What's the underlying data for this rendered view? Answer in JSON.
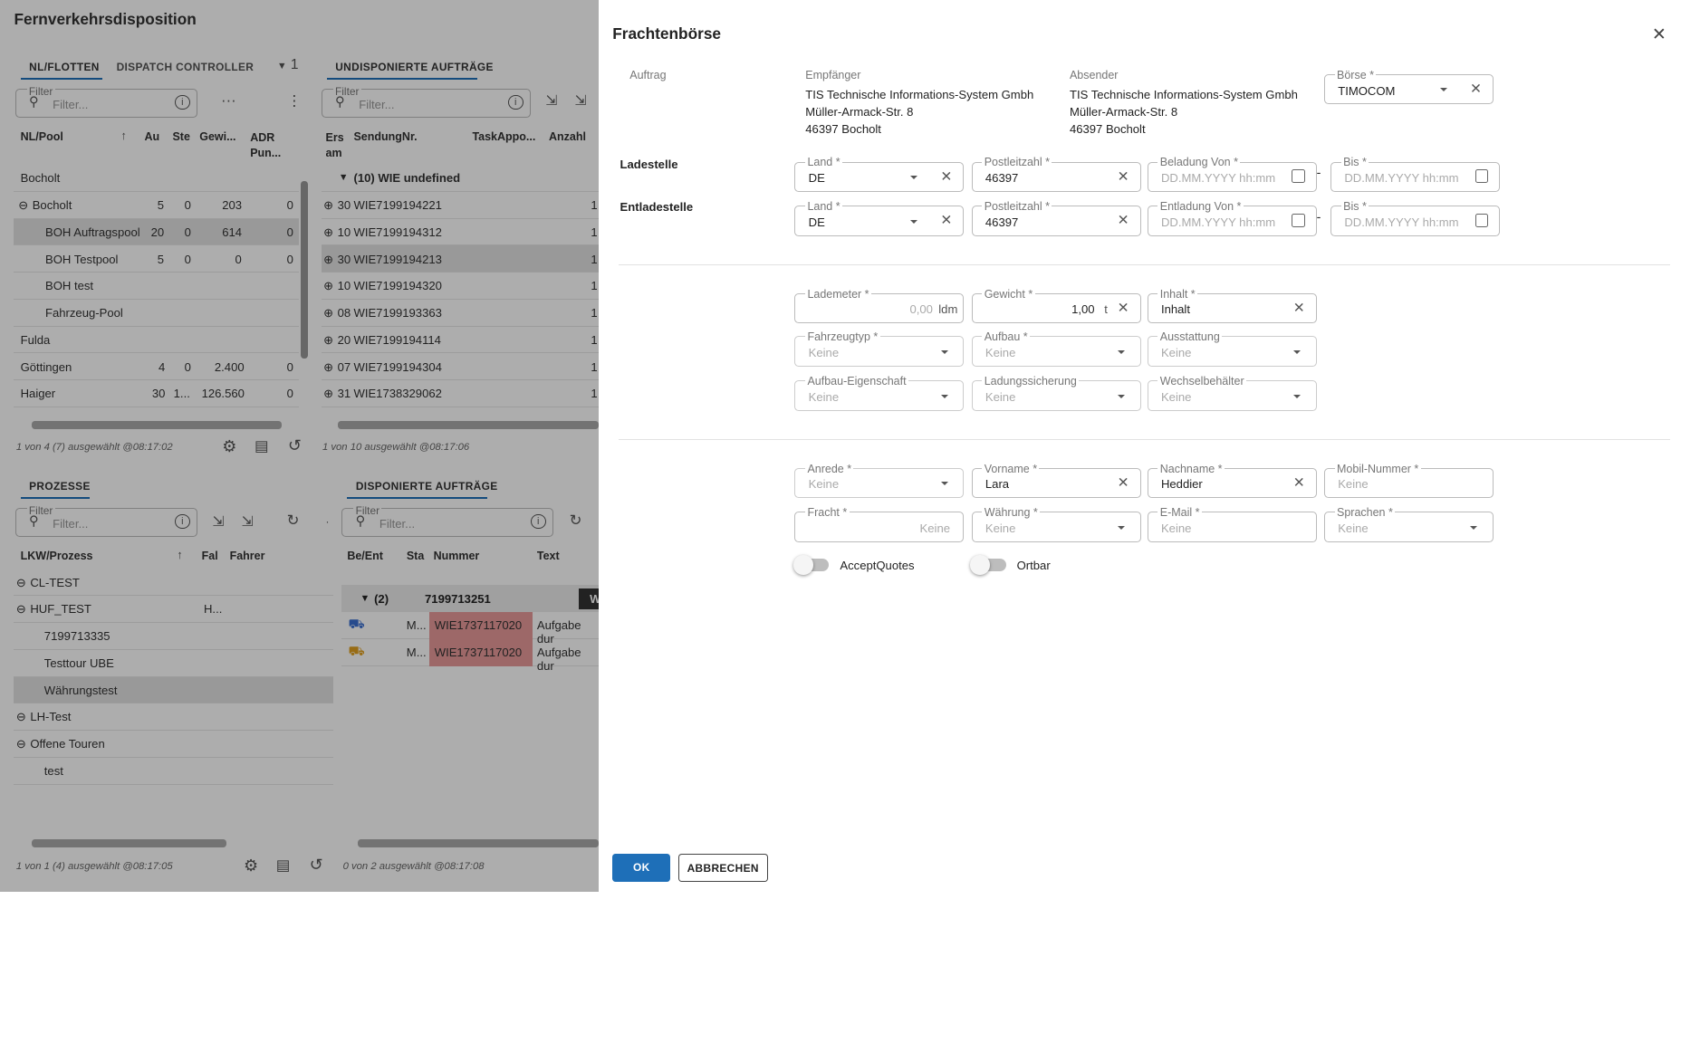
{
  "app": {
    "title": "Fernverkehrsdisposition"
  },
  "panel_nl": {
    "tabs": [
      "NL/FLOTTEN",
      "DISPATCH CONTROLLER"
    ],
    "tab_count": "1",
    "filter_label": "Filter",
    "filter_placeholder": "Filter...",
    "headers": [
      "NL/Pool",
      "Au",
      "Ste",
      "Gewi...",
      "ADR Pun..."
    ],
    "rows": [
      {
        "name": "Bocholt",
        "c1": "",
        "c2": "",
        "c3": "",
        "c4": ""
      },
      {
        "name": "Bocholt",
        "c1": "5",
        "c2": "0",
        "c3": "203",
        "c4": "0"
      },
      {
        "name": "BOH Auftragspool",
        "c1": "20",
        "c2": "0",
        "c3": "614",
        "c4": "0"
      },
      {
        "name": "BOH Testpool",
        "c1": "5",
        "c2": "0",
        "c3": "0",
        "c4": "0"
      },
      {
        "name": "BOH test",
        "c1": "",
        "c2": "",
        "c3": "",
        "c4": ""
      },
      {
        "name": "Fahrzeug-Pool",
        "c1": "",
        "c2": "",
        "c3": "",
        "c4": ""
      },
      {
        "name": "Fulda",
        "c1": "",
        "c2": "",
        "c3": "",
        "c4": ""
      },
      {
        "name": "Göttingen",
        "c1": "4",
        "c2": "0",
        "c3": "2.400",
        "c4": "0"
      },
      {
        "name": "Haiger",
        "c1": "30",
        "c2": "1...",
        "c3": "126.560",
        "c4": "0"
      }
    ],
    "status": "1 von 4 (7) ausgewählt @08:17:02"
  },
  "panel_undisp": {
    "tab": "UNDISPONIERTE AUFTRÄGE",
    "filter_label": "Filter",
    "filter_placeholder": "Filter...",
    "headers": [
      "Ers am",
      "SendungNr.",
      "TaskAppo...",
      "Anzahl"
    ],
    "group": "(10) WIE undefined",
    "rows": [
      {
        "a": "30",
        "nr": "WIE7199194221",
        "n": "1"
      },
      {
        "a": "10",
        "nr": "WIE7199194312",
        "n": "1"
      },
      {
        "a": "30",
        "nr": "WIE7199194213",
        "n": "1"
      },
      {
        "a": "10",
        "nr": "WIE7199194320",
        "n": "1"
      },
      {
        "a": "08",
        "nr": "WIE7199193363",
        "n": "1"
      },
      {
        "a": "20",
        "nr": "WIE7199194114",
        "n": "1"
      },
      {
        "a": "07",
        "nr": "WIE7199194304",
        "n": "1"
      },
      {
        "a": "31",
        "nr": "WIE1738329062",
        "n": "1"
      }
    ],
    "status": "1 von 10 ausgewählt @08:17:06"
  },
  "panel_prozesse": {
    "tab": "PROZESSE",
    "filter_label": "Filter",
    "filter_placeholder": "Filter...",
    "headers": [
      "LKW/Prozess",
      "Fal",
      "Fahrer"
    ],
    "rows": [
      {
        "name": "CL-TEST",
        "f": ""
      },
      {
        "name": "HUF_TEST",
        "f": "H..."
      },
      {
        "name": "7199713335",
        "f": ""
      },
      {
        "name": "Testtour UBE",
        "f": ""
      },
      {
        "name": "Währungstest",
        "f": ""
      },
      {
        "name": "LH-Test",
        "f": ""
      },
      {
        "name": "Offene Touren",
        "f": ""
      },
      {
        "name": "test",
        "f": ""
      }
    ],
    "status": "1 von 1 (4) ausgewählt @08:17:05"
  },
  "panel_disp": {
    "tab": "DISPONIERTE AUFTRÄGE",
    "filter_label": "Filter",
    "filter_placeholder": "Filter...",
    "headers": [
      "Be/Ent",
      "Sta",
      "Nummer",
      "Text"
    ],
    "group_count": "(2)",
    "group_nr": "7199713251",
    "group_extra": "W",
    "rows": [
      {
        "sta": "M...",
        "nr": "WIE1737117020",
        "text": "Aufgabe dur"
      },
      {
        "sta": "M...",
        "nr": "WIE1737117020",
        "text": "Aufgabe dur"
      }
    ],
    "status": "0 von 2 ausgewählt @08:17:08"
  },
  "dialog": {
    "title": "Frachtenbörse",
    "auftrag_label": "Auftrag",
    "empfaenger_label": "Empfänger",
    "empfaenger": [
      "TIS Technische Informations-System Gmbh",
      "Müller-Armack-Str. 8",
      "46397 Bocholt"
    ],
    "absender_label": "Absender",
    "absender": [
      "TIS Technische Informations-System Gmbh",
      "Müller-Armack-Str. 8",
      "46397 Bocholt"
    ],
    "boerse_label": "Börse *",
    "boerse_value": "TIMOCOM",
    "ladestelle": "Ladestelle",
    "entladestelle": "Entladestelle",
    "land_label": "Land *",
    "land_value": "DE",
    "plz_label": "Postleitzahl *",
    "plz_value": "46397",
    "beladung_label": "Beladung Von *",
    "entladung_label": "Entladung Von *",
    "bis_label": "Bis *",
    "date_placeholder": "DD.MM.YYYY hh:mm",
    "dash": "-",
    "lademeter_label": "Lademeter *",
    "lademeter_value": "0,00",
    "lademeter_unit": "ldm",
    "gewicht_label": "Gewicht *",
    "gewicht_value": "1,00",
    "gewicht_unit": "t",
    "inhalt_label": "Inhalt *",
    "inhalt_value": "Inhalt",
    "fahrzeugtyp_label": "Fahrzeugtyp *",
    "aufbau_label": "Aufbau *",
    "ausstattung_label": "Ausstattung",
    "aufbau_eig_label": "Aufbau-Eigenschaft",
    "ladungssicherung_label": "Ladungssicherung",
    "wechselbehaelter_label": "Wechselbehälter",
    "keine": "Keine",
    "anrede_label": "Anrede *",
    "vorname_label": "Vorname *",
    "vorname_value": "Lara",
    "nachname_label": "Nachname *",
    "nachname_value": "Heddier",
    "mobil_label": "Mobil-Nummer *",
    "fracht_label": "Fracht *",
    "waehrung_label": "Währung *",
    "email_label": "E-Mail *",
    "sprachen_label": "Sprachen *",
    "accept_quotes": "AcceptQuotes",
    "ortbar": "Ortbar",
    "ok": "OK",
    "abbrechen": "ABBRECHEN"
  }
}
